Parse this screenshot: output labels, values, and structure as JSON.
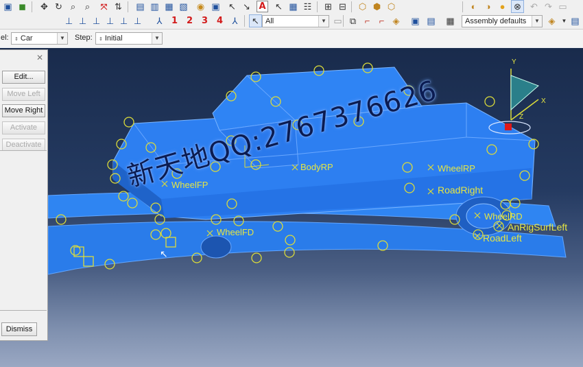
{
  "toolbar": {
    "selection_filter": "All",
    "render_style": "Assembly defaults",
    "number_buttons": [
      "1",
      "2",
      "3",
      "4"
    ],
    "text_tool_glyph": "A",
    "icons_row1": [
      "save-icon",
      "box-icon",
      "pan-icon",
      "rotate-icon",
      "zoom-icon",
      "zoom-box-icon",
      "fit-view-icon",
      "cycle-view-icon",
      "render-wireframe-icon",
      "render-hidden-icon",
      "render-shaded-icon",
      "render-shaded-edges-icon",
      "view-options-icon",
      "query-icon",
      "annotation-icon",
      "measure-icon",
      "text-annotation-icon",
      "select-icon",
      "grid-icon",
      "table-icon",
      "ruler-icon",
      "ruler2-icon",
      "assembly-icon",
      "part-icon",
      "mesh-icon",
      "instance-icon",
      "color-icon",
      "sun-icon",
      "target-icon",
      "undo-icon",
      "redo-icon",
      "help-icon"
    ],
    "icons_row2": [
      "view-xy-icon",
      "view-yx-icon",
      "view-yz-icon",
      "view-zy-icon",
      "view-zx-icon",
      "view-xz-icon",
      "iso-view-icon",
      "select-arrow-icon",
      "filter-icon",
      "deselect-icon",
      "display-group-icon",
      "remove-icon",
      "replace-icon",
      "add-icon",
      "color-map-icon"
    ]
  },
  "context": {
    "model_label": "el:",
    "model_value": "Car",
    "step_label": "Step:",
    "step_value": "Initial"
  },
  "panel": {
    "buttons": [
      {
        "label": "Edit...",
        "enabled": true
      },
      {
        "label": "Move Left",
        "enabled": false
      },
      {
        "label": "Move Right",
        "enabled": true
      },
      {
        "label": "Activate",
        "enabled": false
      },
      {
        "label": "Deactivate",
        "enabled": false
      }
    ],
    "dismiss_label": "Dismiss"
  },
  "viewport": {
    "labels": [
      "WheelFP",
      "WheelRP",
      "RoadRight",
      "WheelFD",
      "WheelRD",
      "AnRigSurfLeft",
      "RoadLeft",
      "BodyRP"
    ],
    "triad": {
      "x": "X",
      "y": "Y",
      "z": "Z"
    },
    "watermark": "新天地QQ:2767376626",
    "colors": {
      "car": "#2d7ff1",
      "car_dark": "#1f63c9",
      "road": "#2f85f2",
      "point": "#dcdc3a",
      "label": "#e6e642"
    }
  }
}
